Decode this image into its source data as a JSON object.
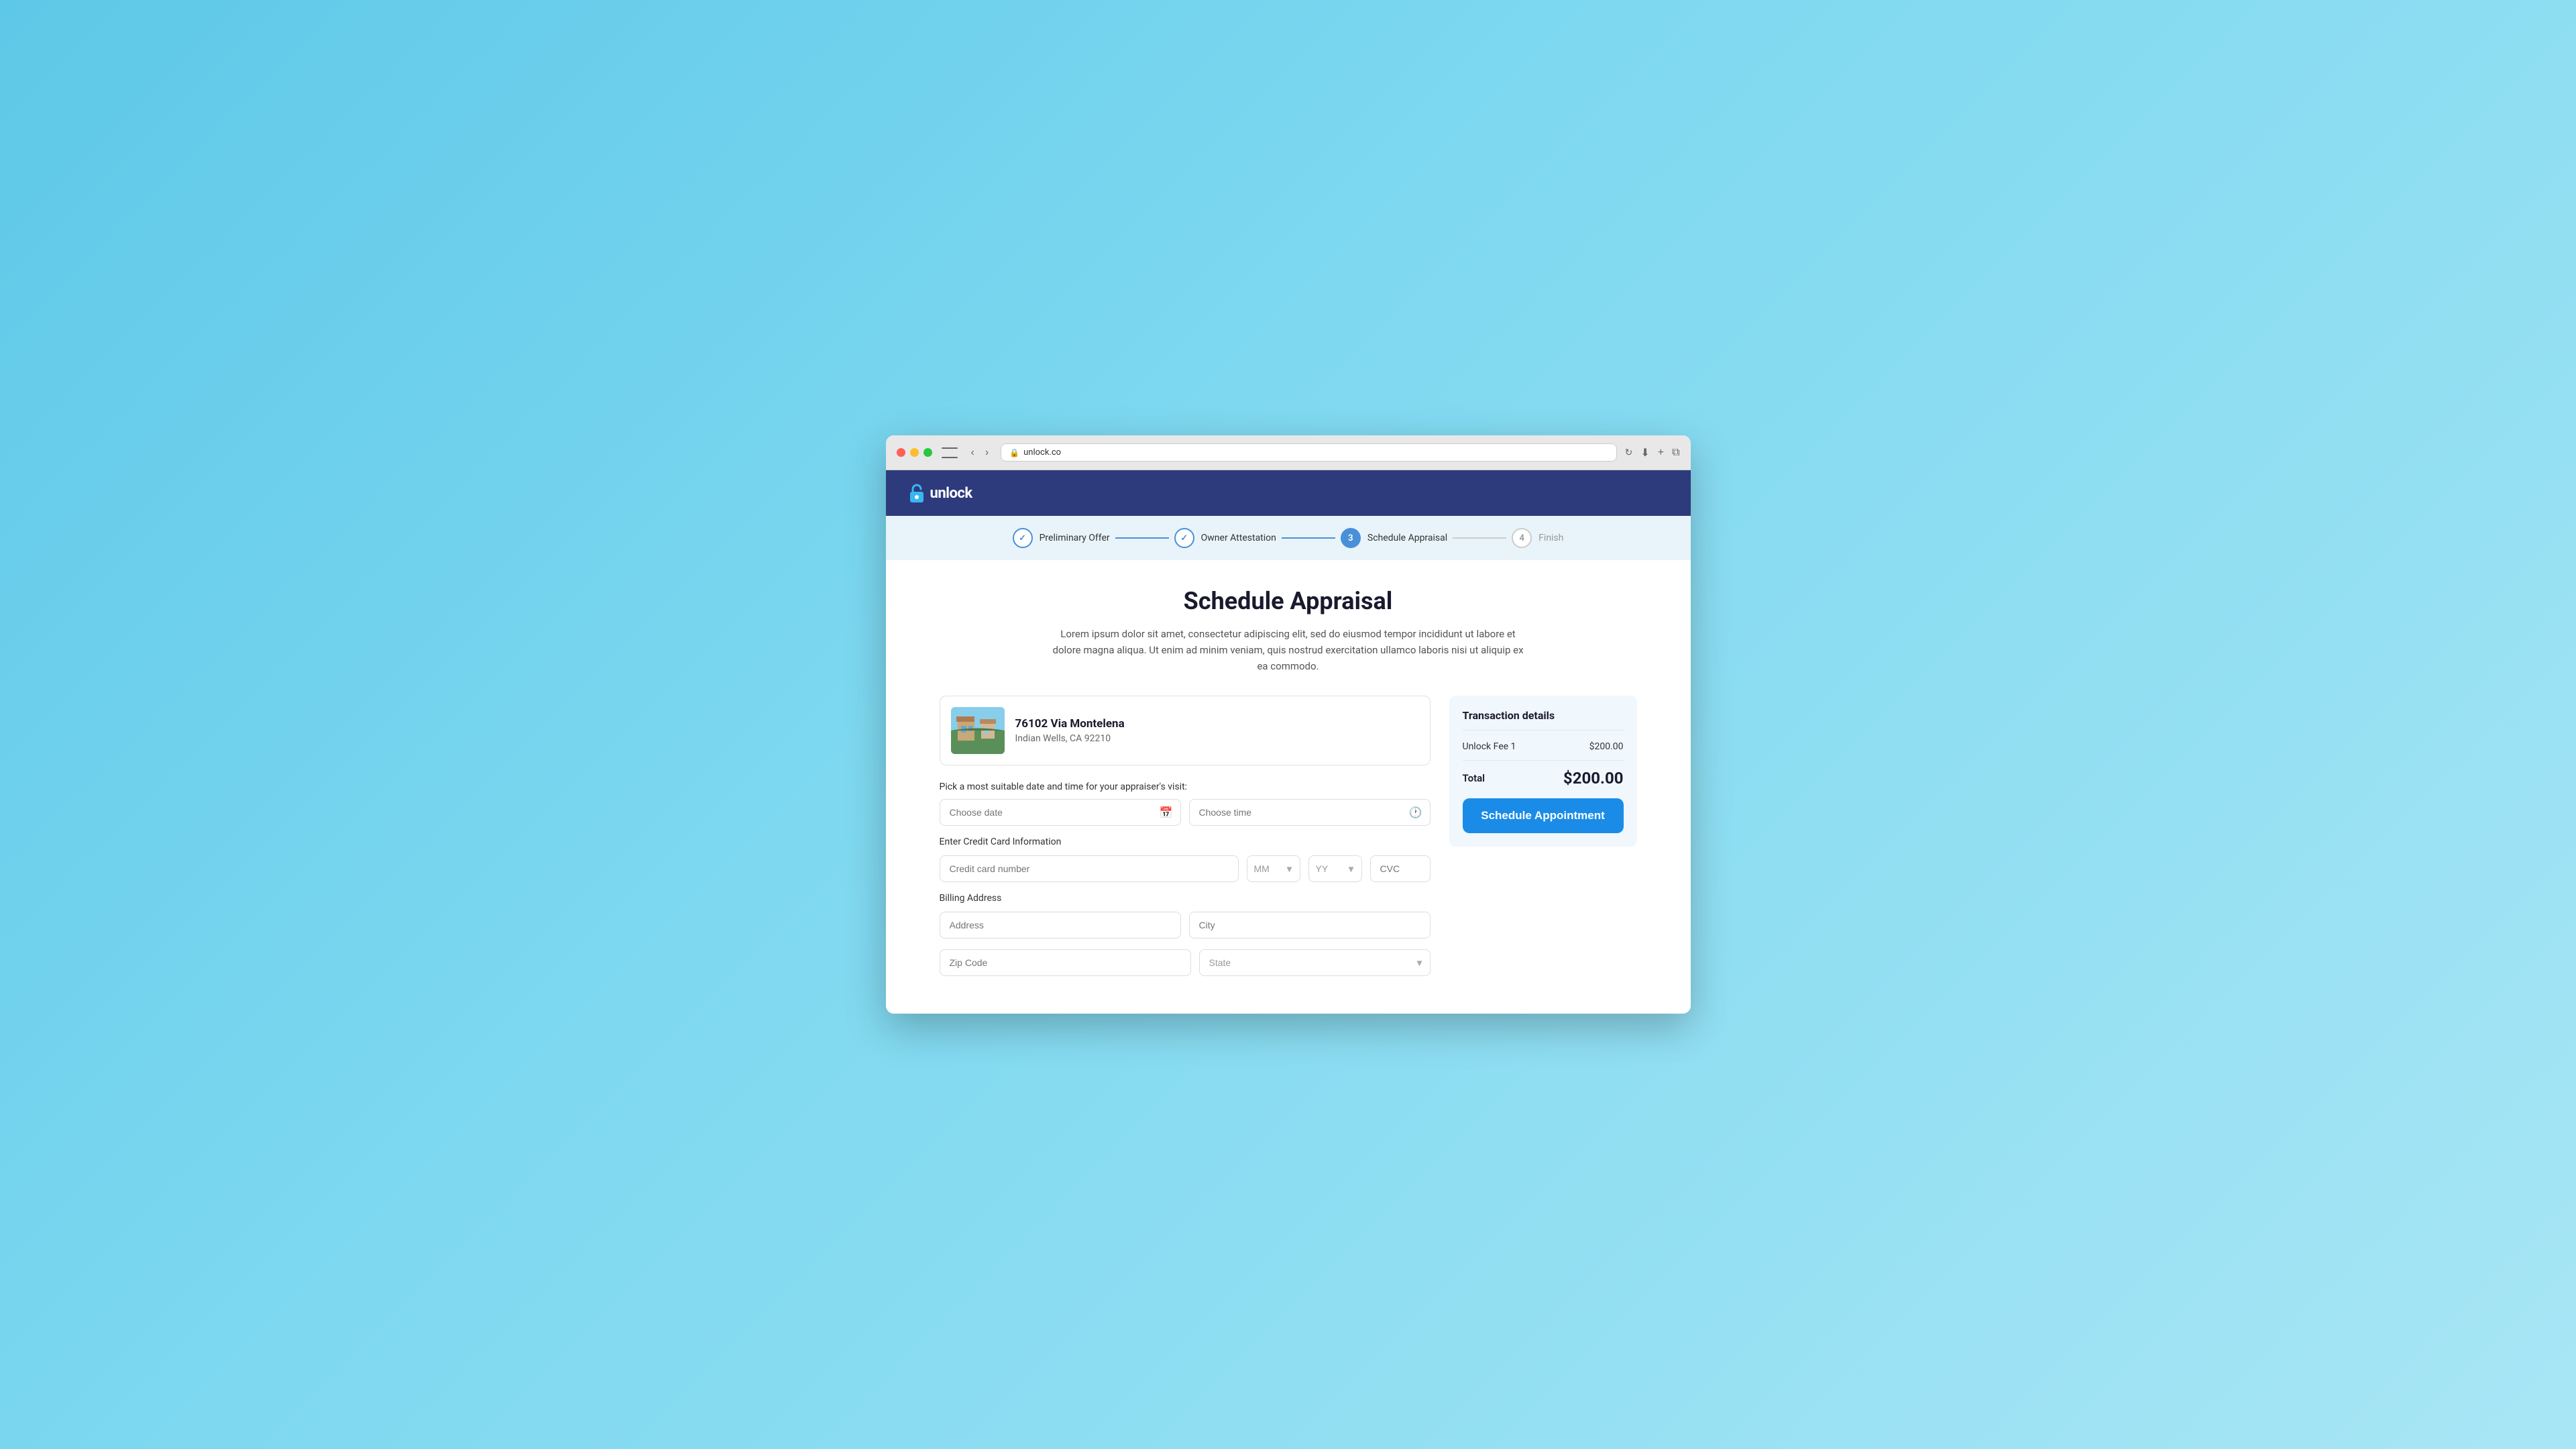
{
  "browser": {
    "url": "unlock.co",
    "nav_back": "‹",
    "nav_forward": "›"
  },
  "logo": {
    "name": "unlock",
    "icon": "🔒"
  },
  "progress": {
    "steps": [
      {
        "id": "preliminary-offer",
        "label": "Preliminary Offer",
        "state": "completed",
        "number": "✓"
      },
      {
        "id": "owner-attestation",
        "label": "Owner Attestation",
        "state": "completed",
        "number": "✓"
      },
      {
        "id": "schedule-appraisal",
        "label": "Schedule Appraisal",
        "state": "active",
        "number": "3"
      },
      {
        "id": "finish",
        "label": "Finish",
        "state": "inactive",
        "number": "4"
      }
    ]
  },
  "page": {
    "title": "Schedule Appraisal",
    "description": "Lorem ipsum dolor sit amet, consectetur adipiscing elit, sed do eiusmod tempor incididunt ut labore et dolore magna aliqua. Ut enim ad minim veniam, quis nostrud exercitation ullamco laboris nisi ut aliquip ex ea commodo."
  },
  "property": {
    "address": "76102 Via Montelena",
    "city_state_zip": "Indian Wells, CA 92210"
  },
  "form": {
    "date_label": "Pick a most suitable date and time for your appraiser's visit:",
    "date_placeholder": "Choose date",
    "time_placeholder": "Choose time",
    "credit_card_section": "Enter Credit Card Information",
    "credit_card_placeholder": "Credit card number",
    "mm_placeholder": "MM",
    "yy_placeholder": "YY",
    "cvc_placeholder": "CVC",
    "billing_section": "Billing Address",
    "address_placeholder": "Address",
    "city_placeholder": "City",
    "zip_placeholder": "Zip Code",
    "state_placeholder": "State"
  },
  "transaction": {
    "title": "Transaction details",
    "fee_label": "Unlock Fee 1",
    "fee_amount": "$200.00",
    "total_label": "Total",
    "total_amount": "$200.00",
    "button_label": "Schedule Appointment"
  }
}
